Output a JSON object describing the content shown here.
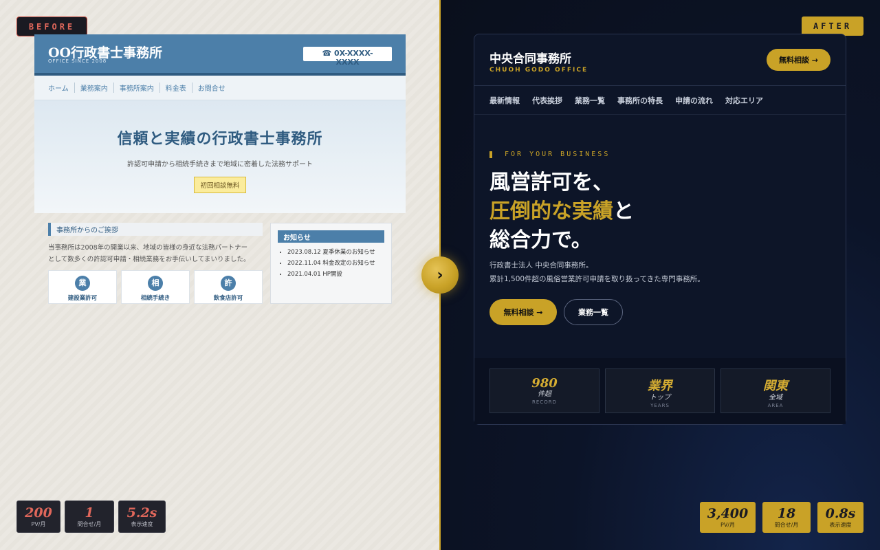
{
  "before": {
    "tag": "BEFORE",
    "site": {
      "title": "OO行政書士事務所",
      "subtitle": "OFFICE SINCE 2008",
      "phone": "☎ 0X-XXXX-XXXX",
      "nav": [
        "ホーム",
        "業務案内",
        "事務所案内",
        "料金表",
        "お問合せ"
      ],
      "hero_title": "信頼と実績の行政書士事務所",
      "hero_text": "許認可申請から相続手続きまで地域に密着した法務サポート",
      "hero_button": "初回相談無料",
      "greeting_heading": "事務所からのご挨拶",
      "greeting_text_1": "当事務所は2008年の開業以来、地域の皆様の身近な法務パートナー",
      "greeting_text_2": "として数多くの許認可申請・相続業務をお手伝いしてまいりました。",
      "services": [
        {
          "icon": "業",
          "label": "建設業許可"
        },
        {
          "icon": "相",
          "label": "相続手続き"
        },
        {
          "icon": "許",
          "label": "飲食店許可"
        }
      ],
      "news_heading": "お知らせ",
      "news": [
        "2023.08.12 夏季休業のお知らせ",
        "2022.11.04 料金改定のお知らせ",
        "2021.04.01 HP開設"
      ]
    },
    "metrics": [
      {
        "value": "200",
        "label": "PV/月"
      },
      {
        "value": "1",
        "label": "問合せ/月"
      },
      {
        "value": "5.2s",
        "label": "表示速度"
      }
    ]
  },
  "after": {
    "tag": "AFTER",
    "site": {
      "title": "中央合同事務所",
      "subtitle": "CHUOH GODO OFFICE",
      "cta": "無料相談 →",
      "nav": [
        "最新情報",
        "代表挨拶",
        "業務一覧",
        "事務所の特長",
        "申請の流れ",
        "対応エリア"
      ],
      "eyebrow": "FOR YOUR BUSINESS",
      "headline_line1": "風営許可を、",
      "headline_line2_gold": "圧倒的な実績",
      "headline_line2_rest": "と",
      "headline_line3": "総合力で。",
      "desc_line1": "行政書士法人 中央合同事務所。",
      "desc_line2": "累計1,500件超の風俗営業許可申請を取り扱ってきた専門事務所。",
      "primary_button": "無料相談 →",
      "secondary_button": "業務一覧",
      "stats": [
        {
          "value": "980",
          "label": "件超",
          "sub": "RECORD"
        },
        {
          "value": "業界",
          "label": "トップ",
          "sub": "YEARS"
        },
        {
          "value": "関東",
          "label": "全域",
          "sub": "AREA"
        }
      ]
    },
    "metrics": [
      {
        "value": "3,400",
        "label": "PV/月"
      },
      {
        "value": "18",
        "label": "問合せ/月"
      },
      {
        "value": "0.8s",
        "label": "表示速度"
      }
    ]
  },
  "arrow": "›",
  "colors": {
    "gold": "#c9a227",
    "old_blue": "#4c7fa9",
    "navy": "#0d1528",
    "red": "#e0675b"
  }
}
